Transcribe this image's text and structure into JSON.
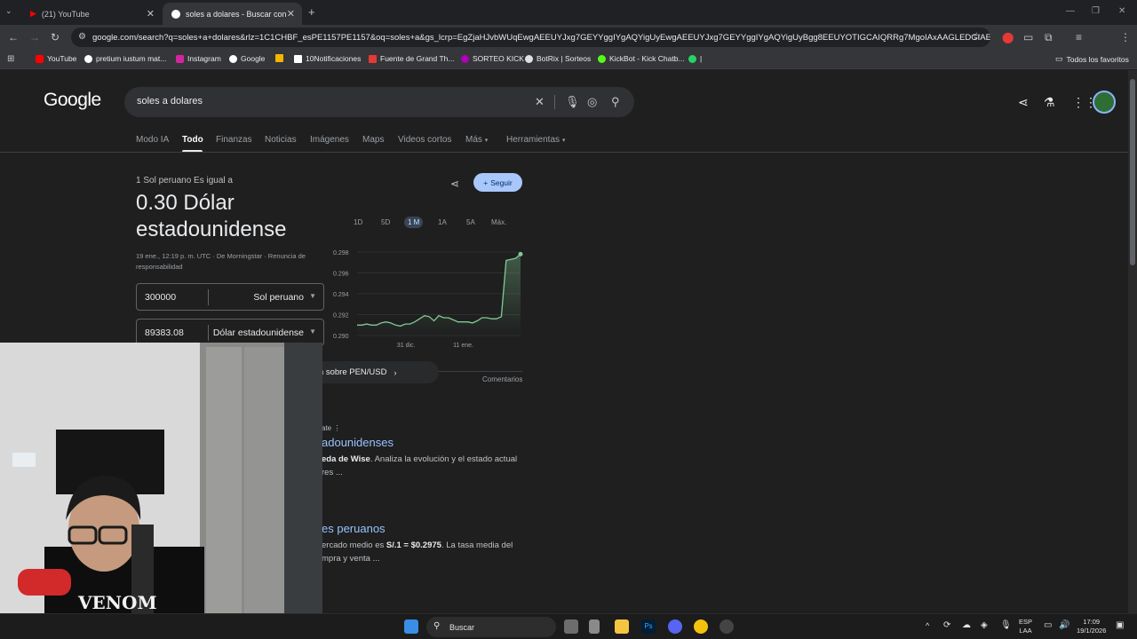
{
  "browser": {
    "tabs": [
      {
        "title": "(21) YouTube"
      },
      {
        "title": "soles a dolares - Buscar con Go"
      }
    ],
    "new_tab": "+",
    "url": "google.com/search?q=soles+a+dolares&rlz=1C1CHBF_esPE1157PE1157&oq=soles+a&gs_lcrp=EgZjaHJvbWUqEwgAEEUYJxg7GEYYggIYgAQYigUyEwgAEEUYJxg7GEYYggIYgAQYigUyBgg8EEUYOTIGCAIQRRg7MgoIAxAAGLEDGIAEMgoIBBA...",
    "bookmarks": [
      "YouTube",
      "pretium iustum mat...",
      "Instagram",
      "Google",
      "10Notificaciones",
      "Fuente de Grand Th...",
      "SORTEO KICK",
      "BotRix | Sorteos",
      "KickBot - Kick Chatb...",
      "|"
    ],
    "all_bookmarks": "Todos los favoritos"
  },
  "google": {
    "logo": "Google",
    "query": "soles a dolares",
    "nav": [
      "Modo IA",
      "Todo",
      "Finanzas",
      "Noticias",
      "Imágenes",
      "Maps",
      "Videos cortos",
      "Más",
      "Herramientas"
    ]
  },
  "converter": {
    "equals_label": "1 Sol peruano Es igual a",
    "value": "0.30 Dólar estadounidense",
    "source": "19 ene., 12:19 p. m. UTC · De Morningstar · Renuncia de responsabilidad",
    "from_amount": "300000",
    "from_currency": "Sol peruano",
    "to_amount": "89383.08",
    "to_currency": "Dólar estadounidense",
    "follow": "Seguir",
    "ranges": [
      "1D",
      "5D",
      "1 M",
      "1A",
      "5A",
      "Máx."
    ],
    "more_info": "Más información sobre PEN/USD",
    "feedback": "Comentarios"
  },
  "chart_data": {
    "type": "area",
    "y_ticks": [
      "0.298",
      "0.296",
      "0.294",
      "0.292",
      "0.290"
    ],
    "x_ticks": [
      "31 dic.",
      "11 ene."
    ],
    "ylim": [
      0.29,
      0.298
    ],
    "values": [
      0.291,
      0.291,
      0.2911,
      0.291,
      0.291,
      0.2912,
      0.2913,
      0.2912,
      0.291,
      0.2909,
      0.2911,
      0.2911,
      0.2913,
      0.2916,
      0.2919,
      0.2918,
      0.2914,
      0.2919,
      0.2917,
      0.2917,
      0.2915,
      0.2913,
      0.2913,
      0.2913,
      0.2912,
      0.2914,
      0.2917,
      0.2917,
      0.2916,
      0.2916,
      0.2918,
      0.2972,
      0.2973,
      0.2974,
      0.2978
    ],
    "color": "#81c995"
  },
  "results": [
    {
      "title": "adounidenses",
      "snippet_bold": "eda de Wise",
      "snippet": ". Analiza la evolución y el estado actual",
      "snippet2": "res ...",
      "label": "ate"
    },
    {
      "title": "es peruanos",
      "snippet_pre": "ercado medio es ",
      "snippet_bold": "S/.1 = $0.2975",
      "snippet": ". La tasa media del",
      "snippet2": "mpra y venta ..."
    }
  ],
  "taskbar": {
    "search": "Buscar",
    "lang": "ESP",
    "lang2": "LAA",
    "time": "17:09",
    "date": "19/1/2026"
  }
}
